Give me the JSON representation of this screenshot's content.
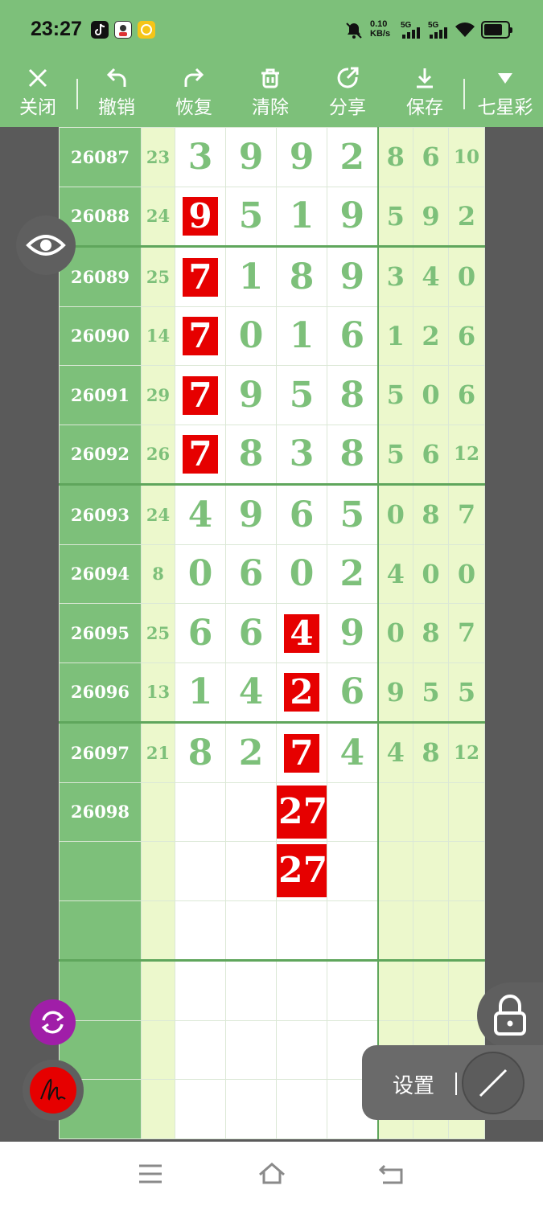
{
  "status_bar": {
    "time": "23:27",
    "net_speed_value": "0.10",
    "net_speed_unit": "KB/s",
    "sim1_label": "5G",
    "sim2_label": "5G",
    "battery_level": 0.8
  },
  "toolbar": {
    "close_label": "关闭",
    "undo_label": "撤销",
    "redo_label": "恢复",
    "clear_label": "清除",
    "share_label": "分享",
    "save_label": "保存",
    "lottery_label": "七星彩"
  },
  "rows": [
    {
      "issue": "26087",
      "sum": "23",
      "digits": [
        "3",
        "9",
        "9",
        "2"
      ],
      "extra": [
        "8",
        "6",
        "10"
      ],
      "hl": -1
    },
    {
      "issue": "26088",
      "sum": "24",
      "digits": [
        "9",
        "5",
        "1",
        "9"
      ],
      "extra": [
        "5",
        "9",
        "2"
      ],
      "hl": 0
    },
    {
      "issue": "26089",
      "sum": "25",
      "digits": [
        "7",
        "1",
        "8",
        "9"
      ],
      "extra": [
        "3",
        "4",
        "0"
      ],
      "hl": 0
    },
    {
      "issue": "26090",
      "sum": "14",
      "digits": [
        "7",
        "0",
        "1",
        "6"
      ],
      "extra": [
        "1",
        "2",
        "6"
      ],
      "hl": 0
    },
    {
      "issue": "26091",
      "sum": "29",
      "digits": [
        "7",
        "9",
        "5",
        "8"
      ],
      "extra": [
        "5",
        "0",
        "6"
      ],
      "hl": 0
    },
    {
      "issue": "26092",
      "sum": "26",
      "digits": [
        "7",
        "8",
        "3",
        "8"
      ],
      "extra": [
        "5",
        "6",
        "12"
      ],
      "hl": 0
    },
    {
      "issue": "26093",
      "sum": "24",
      "digits": [
        "4",
        "9",
        "6",
        "5"
      ],
      "extra": [
        "0",
        "8",
        "7"
      ],
      "hl": -1
    },
    {
      "issue": "26094",
      "sum": "8",
      "digits": [
        "0",
        "6",
        "0",
        "2"
      ],
      "extra": [
        "4",
        "0",
        "0"
      ],
      "hl": -1
    },
    {
      "issue": "26095",
      "sum": "25",
      "digits": [
        "6",
        "6",
        "4",
        "9"
      ],
      "extra": [
        "0",
        "8",
        "7"
      ],
      "hl": 2
    },
    {
      "issue": "26096",
      "sum": "13",
      "digits": [
        "1",
        "4",
        "2",
        "6"
      ],
      "extra": [
        "9",
        "5",
        "5"
      ],
      "hl": 2
    },
    {
      "issue": "26097",
      "sum": "21",
      "digits": [
        "8",
        "2",
        "7",
        "4"
      ],
      "extra": [
        "4",
        "8",
        "12"
      ],
      "hl": 2
    },
    {
      "issue": "26098",
      "sum": "",
      "digits": [
        "",
        "",
        "27",
        ""
      ],
      "extra": [
        "",
        "",
        ""
      ],
      "hl": 2
    },
    {
      "issue": "",
      "sum": "",
      "digits": [
        "",
        "",
        "27",
        ""
      ],
      "extra": [
        "",
        "",
        ""
      ],
      "hl": 2
    },
    {
      "issue": "",
      "sum": "",
      "digits": [
        "",
        "",
        "",
        ""
      ],
      "extra": [
        "",
        "",
        ""
      ],
      "hl": -1
    },
    {
      "issue": "",
      "sum": "",
      "digits": [
        "",
        "",
        "",
        ""
      ],
      "extra": [
        "",
        "",
        ""
      ],
      "hl": -1
    },
    {
      "issue": "",
      "sum": "",
      "digits": [
        "",
        "",
        "",
        ""
      ],
      "extra": [
        "",
        "",
        ""
      ],
      "hl": -1
    },
    {
      "issue": "",
      "sum": "",
      "digits": [
        "",
        "",
        "",
        ""
      ],
      "extra": [
        "",
        "",
        ""
      ],
      "hl": -1
    }
  ],
  "group_start_rows": [
    2,
    6,
    10,
    14
  ],
  "settings_label": "设置",
  "colors": {
    "theme_green": "#7dc07a",
    "highlight_red": "#e60000",
    "pale_green": "#ecf8cc",
    "sync_purple": "#a01ea8"
  }
}
